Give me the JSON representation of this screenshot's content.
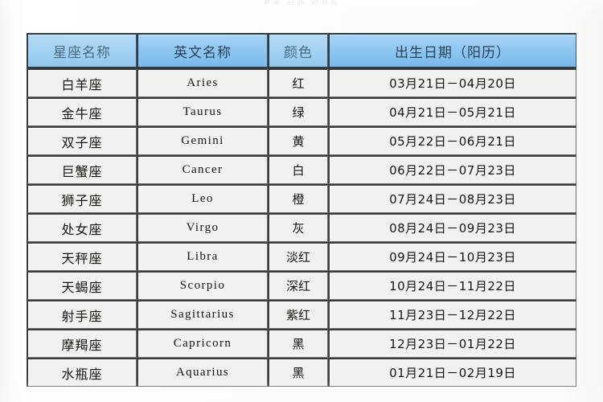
{
  "page": {
    "top_clipped_text": "星座   日期   对照表"
  },
  "table": {
    "columns": [
      {
        "label": "星座名称",
        "key": "name"
      },
      {
        "label": "英文名称",
        "key": "english"
      },
      {
        "label": "颜色",
        "key": "color"
      },
      {
        "label": "出生日期（阳历）",
        "key": "date"
      }
    ],
    "header_bg": "#8cc4f0",
    "header_text_color": "#2c4256",
    "row_bg": "#f1f2ef",
    "border_color": "#3b3b3b",
    "rows": [
      {
        "name": "白羊座",
        "english": "Aries",
        "color": "红",
        "date": "03月21日－04月20日"
      },
      {
        "name": "金牛座",
        "english": "Taurus",
        "color": "绿",
        "date": "04月21日－05月21日"
      },
      {
        "name": "双子座",
        "english": "Gemini",
        "color": "黄",
        "date": "05月22日－06月21日"
      },
      {
        "name": "巨蟹座",
        "english": "Cancer",
        "color": "白",
        "date": "06月22日－07月23日"
      },
      {
        "name": "狮子座",
        "english": "Leo",
        "color": "橙",
        "date": "07月24日－08月23日"
      },
      {
        "name": "处女座",
        "english": "Virgo",
        "color": "灰",
        "date": "08月24日－09月23日"
      },
      {
        "name": "天秤座",
        "english": "Libra",
        "color": "淡红",
        "date": "09月24日－10月23日"
      },
      {
        "name": "天蝎座",
        "english": "Scorpio",
        "color": "深红",
        "date": "10月24日－11月22日"
      },
      {
        "name": "射手座",
        "english": "Sagittarius",
        "color": "紫红",
        "date": "11月23日－12月22日"
      },
      {
        "name": "摩羯座",
        "english": "Capricorn",
        "color": "黑",
        "date": "12月23日－01月22日"
      },
      {
        "name": "水瓶座",
        "english": "Aquarius",
        "color": "黑",
        "date": "01月21日－02月19日"
      }
    ]
  }
}
